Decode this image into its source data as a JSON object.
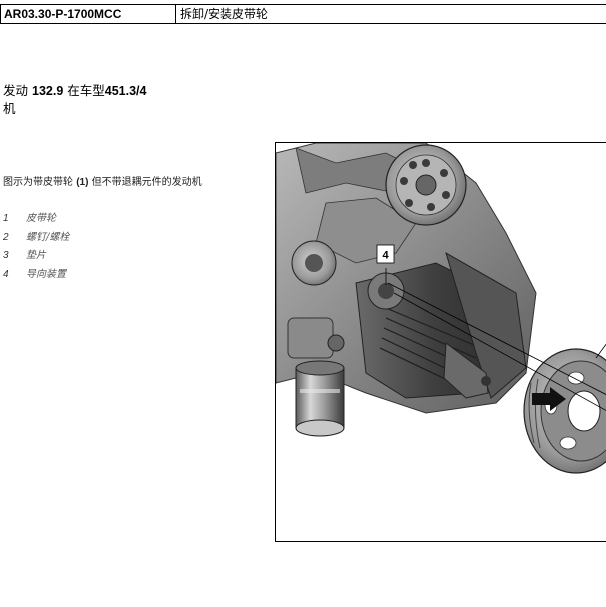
{
  "header": {
    "code": "AR03.30-P-1700MCC",
    "title": "拆卸/安装皮带轮"
  },
  "engine": {
    "prefix": "发动",
    "number": "132.9",
    "mid": "在车型",
    "models": "451.3/4",
    "suffix": "机"
  },
  "caption": {
    "before": "图示为带皮带轮",
    "ref": "(1)",
    "after": "但不带退耦元件的发动机"
  },
  "legend": [
    {
      "num": "1",
      "label": "皮带轮"
    },
    {
      "num": "2",
      "label": "螺钉/螺栓"
    },
    {
      "num": "3",
      "label": "垫片"
    },
    {
      "num": "4",
      "label": "导向装置"
    }
  ],
  "figure": {
    "callout": "4"
  }
}
